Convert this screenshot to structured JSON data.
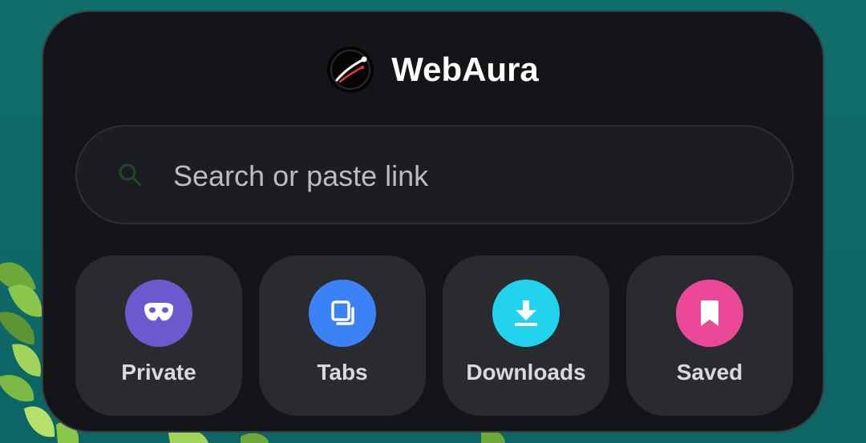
{
  "brand": {
    "name": "WebAura",
    "logo_icon": "speed-comet-logo"
  },
  "search": {
    "placeholder": "Search or paste link",
    "icon": "search-icon"
  },
  "shortcuts": [
    {
      "label": "Private",
      "icon": "incognito-mask-icon",
      "color": "#6a5acd"
    },
    {
      "label": "Tabs",
      "icon": "tabs-icon",
      "color": "#3b82f6"
    },
    {
      "label": "Downloads",
      "icon": "download-icon",
      "color": "#22d3ee"
    },
    {
      "label": "Saved",
      "icon": "bookmark-icon",
      "color": "#ec4899"
    }
  ],
  "colors": {
    "widget_background": "#141519",
    "search_background": "#1c1d22",
    "tile_background": "#2a2b2f",
    "wallpaper": "#0f6e6a"
  }
}
